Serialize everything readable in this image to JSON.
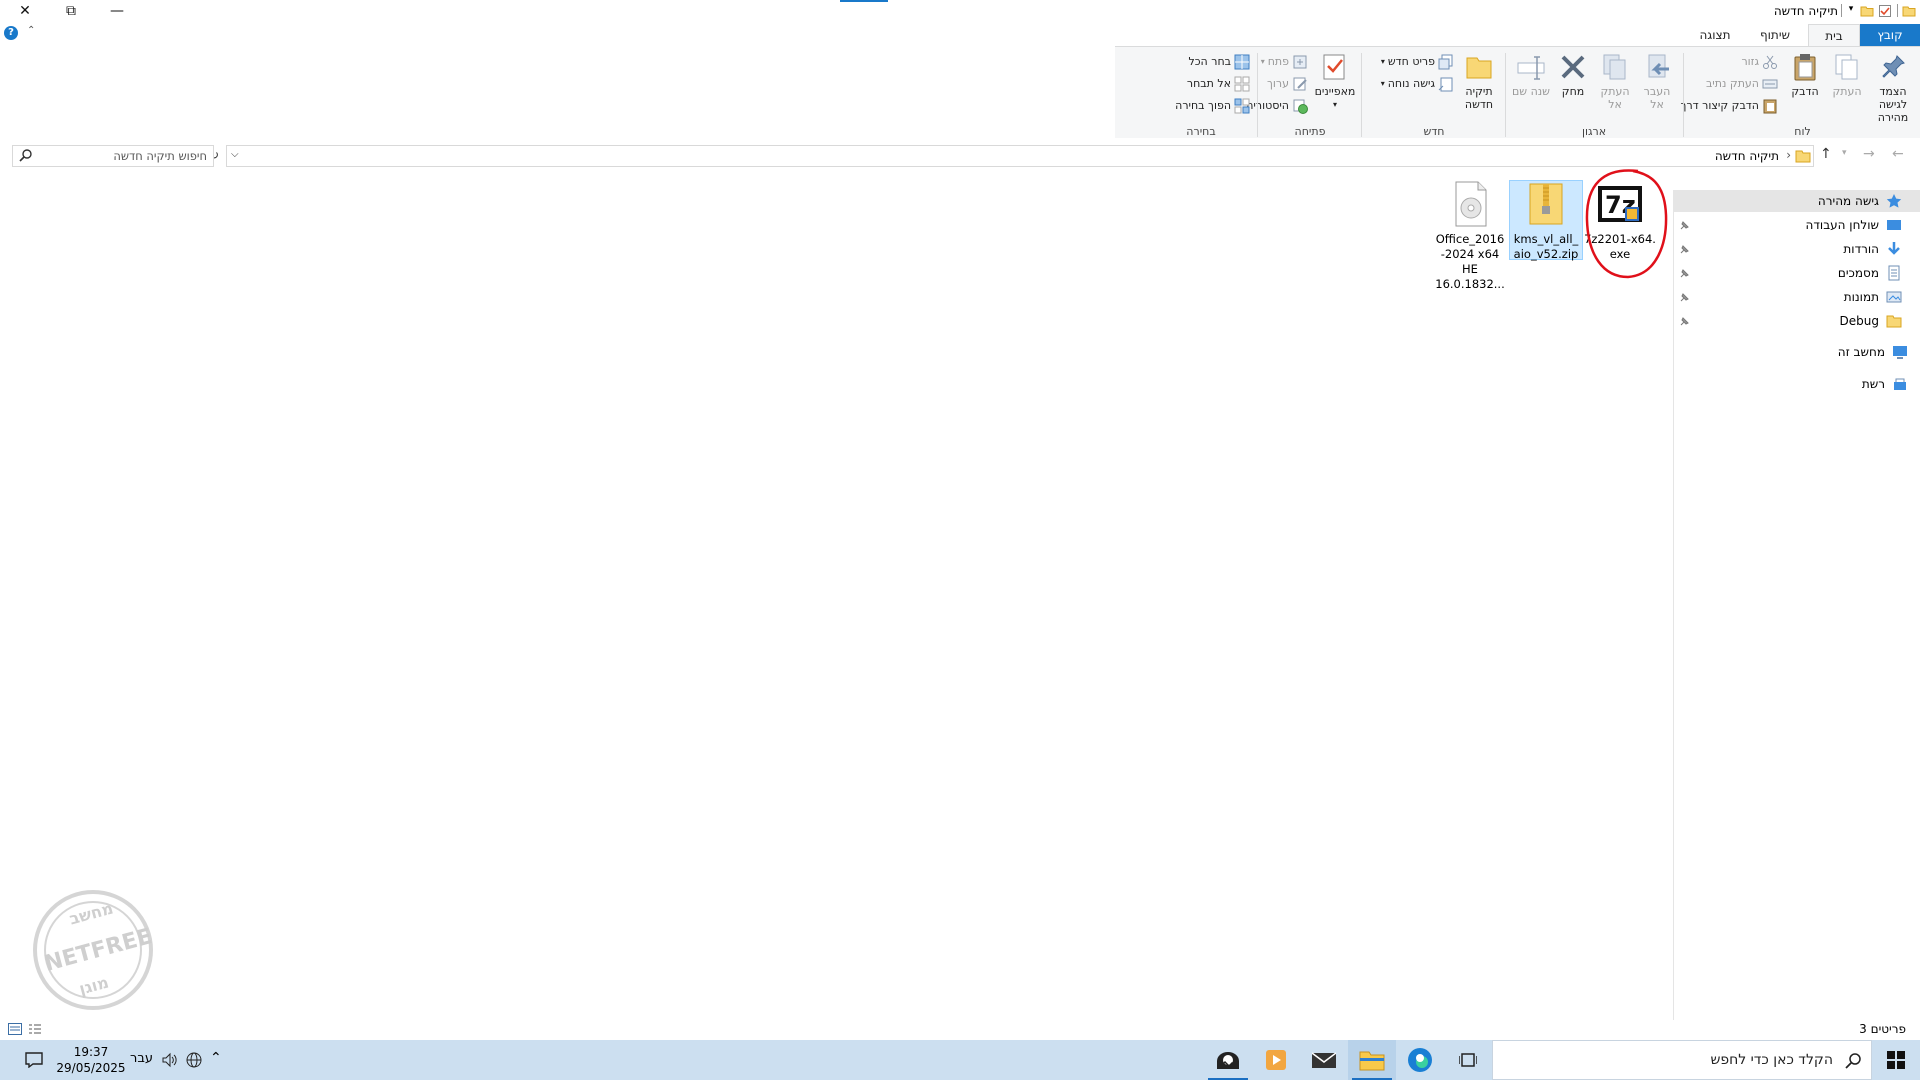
{
  "window": {
    "title": "תיקיה חדשה",
    "controls": {
      "close": "✕",
      "restore": "⧉",
      "minimize": "—"
    }
  },
  "ribbon": {
    "tabs": [
      "קובץ",
      "בית",
      "שיתוף",
      "תצוגה"
    ],
    "groups": {
      "clipboard": {
        "label": "לוח",
        "pin": "הצמד לגישה מהירה",
        "copy": "העתק",
        "paste": "הדבק",
        "cut": "גזור",
        "copy_path": "העתק נתיב",
        "paste_shortcut": "הדבק קיצור דרך"
      },
      "organize": {
        "label": "ארגון",
        "move_to": "העבר אל",
        "copy_to": "העתק אל",
        "delete": "מחק",
        "rename": "שנה שם"
      },
      "new": {
        "label": "חדש",
        "new_folder": "תיקיה חדשה",
        "new_item": "פריט חדש",
        "easy_access": "גישה נוחה"
      },
      "open": {
        "label": "פתיחה",
        "properties": "מאפיינים",
        "open": "פתח",
        "edit": "ערוך",
        "history": "היסטוריה"
      },
      "select": {
        "label": "בחירה",
        "select_all": "בחר הכל",
        "select_none": "אל תבחר",
        "invert": "הפוך בחירה"
      }
    }
  },
  "addressbar": {
    "path": "תיקיה חדשה",
    "search_placeholder": "חיפוש תיקיה חדשה"
  },
  "navpane": {
    "quick_access": "גישה מהירה",
    "items": [
      "שולחן העבודה",
      "הורדות",
      "מסמכים",
      "תמונות",
      "Debug"
    ],
    "this_pc": "מחשב זה",
    "network": "רשת"
  },
  "files": [
    {
      "name_line1": "7z2201-x64.",
      "name_line2": "exe",
      "type": "exe"
    },
    {
      "name_line1": "kms_vl_all_",
      "name_line2": "aio_v52.zip",
      "type": "zip"
    },
    {
      "name_line1": "Office_2016",
      "name_line2": "-2024 x64",
      "name_line3": "HE",
      "name_line4": "16.0.1832...",
      "type": "iso"
    }
  ],
  "status": {
    "count": "3 פריטים"
  },
  "watermark": {
    "line1": "מחשב",
    "line2": "NETFREE",
    "line3": "מוגן"
  },
  "taskbar": {
    "search_placeholder": "הקלד כאן כדי לחפש",
    "time": "19:37",
    "date": "29/05/2025",
    "lang": "עבר"
  },
  "colors": {
    "accent": "#1979ca",
    "taskbar": "#ccdff0",
    "annotation": "#e0101a"
  }
}
